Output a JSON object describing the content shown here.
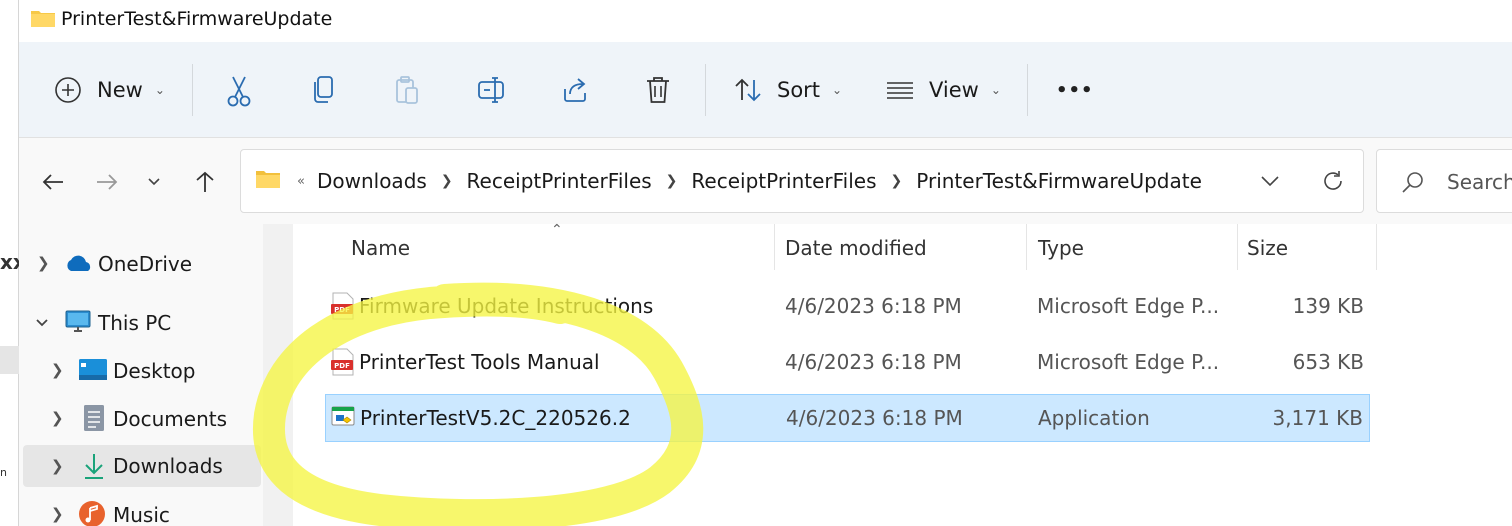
{
  "window": {
    "title": "PrinterTest&FirmwareUpdate",
    "behind_text": "xx",
    "behind_text2": "n"
  },
  "toolbar": {
    "new_label": "New",
    "sort_label": "Sort",
    "view_label": "View",
    "more_label": "•••"
  },
  "address": {
    "overflow": "«",
    "crumbs": [
      "Downloads",
      "ReceiptPrinterFiles",
      "ReceiptPrinterFiles",
      "PrinterTest&FirmwareUpdate"
    ],
    "search_placeholder": "Search"
  },
  "sidebar": {
    "items": [
      {
        "label": "OneDrive",
        "expanded": false
      },
      {
        "label": "This PC",
        "expanded": true
      },
      {
        "label": "Desktop",
        "expanded": false
      },
      {
        "label": "Documents",
        "expanded": false
      },
      {
        "label": "Downloads",
        "expanded": false,
        "selected": true
      },
      {
        "label": "Music",
        "expanded": false
      }
    ]
  },
  "columns": {
    "name": "Name",
    "date": "Date modified",
    "type": "Type",
    "size": "Size"
  },
  "files": [
    {
      "name": "Firmware Update Instructions",
      "date": "4/6/2023 6:18 PM",
      "type": "Microsoft Edge P...",
      "size": "139 KB",
      "icon": "pdf-icon"
    },
    {
      "name": "PrinterTest Tools Manual",
      "date": "4/6/2023 6:18 PM",
      "type": "Microsoft Edge P...",
      "size": "653 KB",
      "icon": "pdf-icon"
    },
    {
      "name": "PrinterTestV5.2C_220526.2",
      "date": "4/6/2023 6:18 PM",
      "type": "Application",
      "size": "3,171 KB",
      "icon": "application-icon",
      "selected": true
    }
  ],
  "annotation": {
    "color": "#f5f542",
    "shape": "hand-drawn-circle"
  }
}
